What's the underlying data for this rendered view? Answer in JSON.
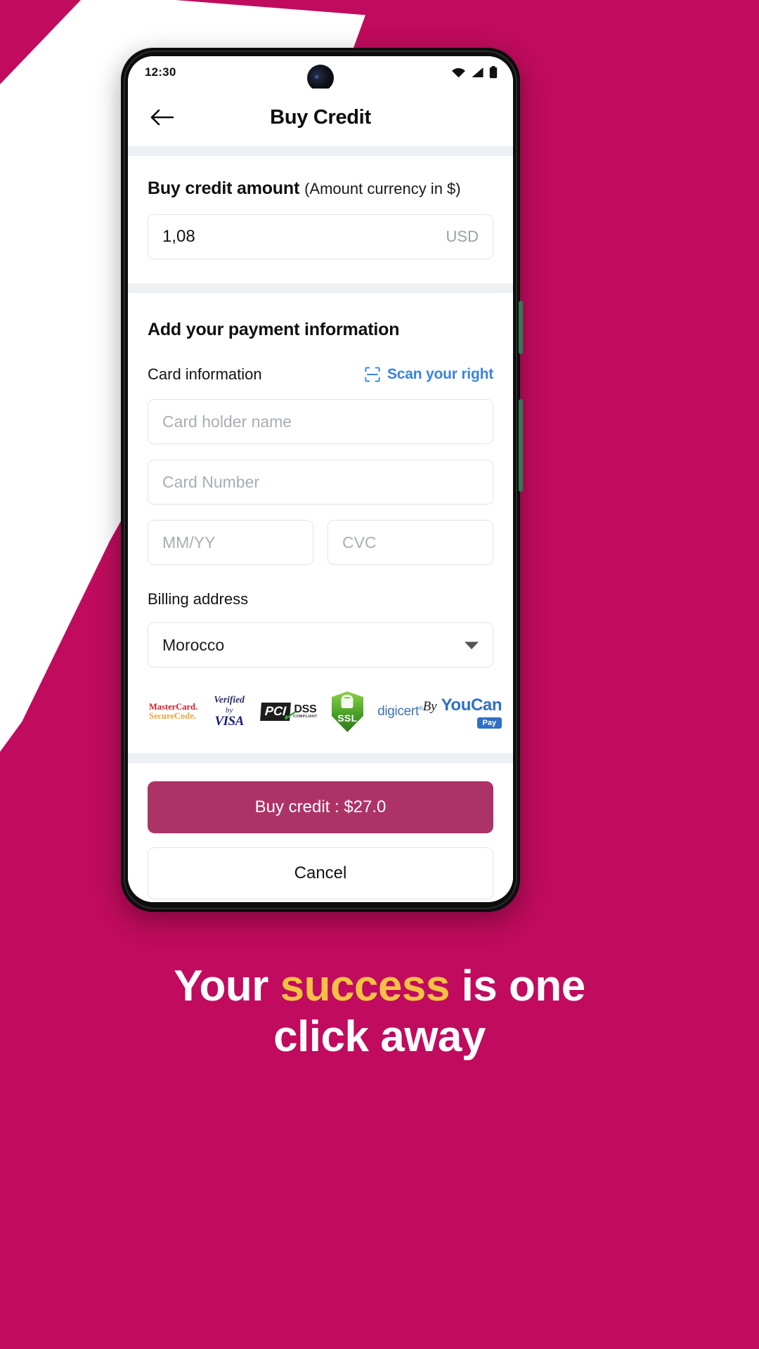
{
  "background": {
    "brand_color": "#C00B5E",
    "accent_color": "#F5C145"
  },
  "phone": {
    "status_bar": {
      "time": "12:30",
      "icons": [
        "wifi-icon",
        "cellular-signal-icon",
        "battery-icon"
      ]
    },
    "app_bar": {
      "back_icon": "arrow-left-icon",
      "title": "Buy Credit"
    },
    "amount_section": {
      "title": "Buy credit amount",
      "subtitle": "(Amount currency in $)",
      "value": "1,08",
      "currency": "USD"
    },
    "payment_section": {
      "title": "Add your payment information",
      "card_information_label": "Card information",
      "scan_icon": "scan-frame-icon",
      "scan_label": "Scan your right",
      "fields": {
        "card_holder_placeholder": "Card holder name",
        "card_number_placeholder": "Card Number",
        "expiry_placeholder": "MM/YY",
        "cvc_placeholder": "CVC"
      },
      "billing_address_label": "Billing address",
      "country_value": "Morocco",
      "country_dropdown_icon": "chevron-down-icon"
    },
    "trust_badges": {
      "mastercard": {
        "line1": "MasterCard.",
        "line2": "SecureCode."
      },
      "visa": {
        "top": "Verified",
        "top_by": "by",
        "bottom": "VISA"
      },
      "pci": {
        "mark": "PCI",
        "dss": "DSS",
        "compliant": "COMPLIANT"
      },
      "ssl": {
        "label": "SSL",
        "icon": "lock-shield-icon"
      },
      "digicert": "digicert",
      "provider": {
        "by": "By",
        "name": "YouCan",
        "chip": "Pay"
      }
    },
    "actions": {
      "primary_label": "Buy credit : $27.0",
      "secondary_label": "Cancel"
    }
  },
  "tagline": {
    "part1": "Your ",
    "highlight": "success",
    "part2": " is one",
    "line2": "click away"
  }
}
